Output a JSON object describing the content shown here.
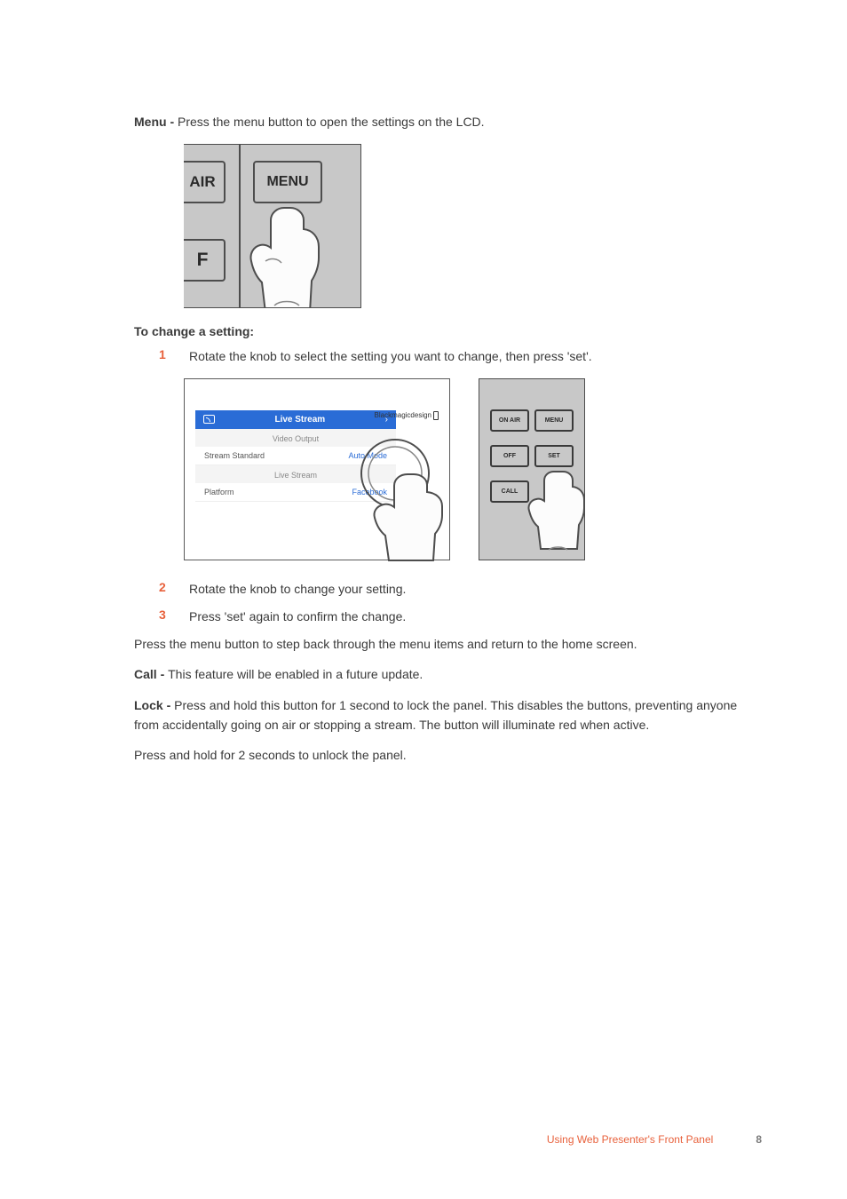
{
  "menu_line": {
    "b": "Menu - ",
    "t": "Press the menu button to open the settings on the LCD."
  },
  "fig1": {
    "air": "AIR",
    "menu": "MENU",
    "f": "F"
  },
  "heading": "To change a setting:",
  "steps": [
    {
      "n": "1",
      "t": "Rotate the knob to select the setting you want to change, then press 'set'."
    },
    {
      "n": "2",
      "t": "Rotate the knob to change your setting."
    },
    {
      "n": "3",
      "t": "Press 'set' again to confirm the change."
    }
  ],
  "fig2": {
    "title": "Live Stream",
    "chev": "›",
    "brand": "Blackmagicdesign",
    "sec1": "Video Output",
    "row1": {
      "l": "Stream Standard",
      "v": "Auto Mode"
    },
    "sec2": "Live Stream",
    "row2": {
      "l": "Platform",
      "v": "Facebook"
    },
    "btns": {
      "onair": "ON AIR",
      "menu": "MENU",
      "off": "OFF",
      "set": "SET",
      "call": "CALL"
    }
  },
  "p_back": "Press the menu button to step back through the menu items and return to the home screen.",
  "call": {
    "b": "Call - ",
    "t": "This feature will be enabled in a future update."
  },
  "lock": {
    "b": "Lock - ",
    "t": "Press and hold this button for 1 second to lock the panel. This disables the buttons, preventing anyone from accidentally going on air or stopping a stream. The button will illuminate red when active."
  },
  "unlock": "Press and hold for 2 seconds to unlock the panel.",
  "footer": {
    "title": "Using Web Presenter's Front Panel",
    "page": "8"
  }
}
